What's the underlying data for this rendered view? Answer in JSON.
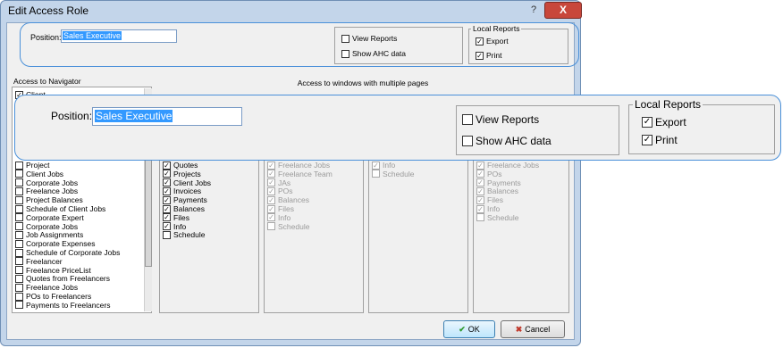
{
  "window": {
    "title": "Edit Access Role",
    "help_label": "?",
    "close_label": "X"
  },
  "position": {
    "label": "Position:",
    "value": "Sales Executive"
  },
  "view_options": {
    "view_reports": {
      "label": "View Reports",
      "checked": false
    },
    "show_ahc": {
      "label": "Show AHC data",
      "checked": false
    }
  },
  "local_reports": {
    "title": "Local Reports",
    "export": {
      "label": "Export",
      "checked": true
    },
    "print": {
      "label": "Print",
      "checked": true
    }
  },
  "navigator": {
    "title": "Access to Navigator",
    "top_item": "Client",
    "items": [
      "Project",
      "Client Jobs",
      "Corporate Jobs",
      "Freelance Jobs",
      "Project Balances",
      "Schedule of Client Jobs",
      "Corporate Expert",
      "Corporate Jobs",
      "Job Assignments",
      "Corporate Expenses",
      "Schedule of Corporate Jobs",
      "Freelancer",
      "Freelance PriceList",
      "Quotes from Freelancers",
      "Freelance Jobs",
      "POs to Freelancers",
      "Payments to Freelancers"
    ]
  },
  "multi_pages": {
    "title": "Access to windows with multiple pages",
    "col1": [
      {
        "label": "Quotes",
        "checked": true
      },
      {
        "label": "Projects",
        "checked": true
      },
      {
        "label": "Client Jobs",
        "checked": true
      },
      {
        "label": "Invoices",
        "checked": true
      },
      {
        "label": "Payments",
        "checked": true
      },
      {
        "label": "Balances",
        "checked": true
      },
      {
        "label": "Files",
        "checked": true
      },
      {
        "label": "Info",
        "checked": true
      },
      {
        "label": "Schedule",
        "checked": false
      }
    ],
    "col2": [
      {
        "label": "Freelance Jobs",
        "checked": true
      },
      {
        "label": "Freelance Team",
        "checked": true
      },
      {
        "label": "JAs",
        "checked": true
      },
      {
        "label": "POs",
        "checked": true
      },
      {
        "label": "Balances",
        "checked": true
      },
      {
        "label": "Files",
        "checked": true
      },
      {
        "label": "Info",
        "checked": true
      },
      {
        "label": "Schedule",
        "checked": false
      }
    ],
    "col3": [
      {
        "label": "Info",
        "checked": true
      },
      {
        "label": "Schedule",
        "checked": false
      }
    ],
    "col4": [
      {
        "label": "Freelance Jobs",
        "checked": true
      },
      {
        "label": "POs",
        "checked": true
      },
      {
        "label": "Payments",
        "checked": true
      },
      {
        "label": "Balances",
        "checked": true
      },
      {
        "label": "Files",
        "checked": true
      },
      {
        "label": "Info",
        "checked": true
      },
      {
        "label": "Schedule",
        "checked": false
      }
    ]
  },
  "buttons": {
    "ok": "OK",
    "cancel": "Cancel"
  },
  "colors": {
    "accent": "#4a90d9",
    "selection": "#3399ff",
    "close": "#c8473b"
  }
}
